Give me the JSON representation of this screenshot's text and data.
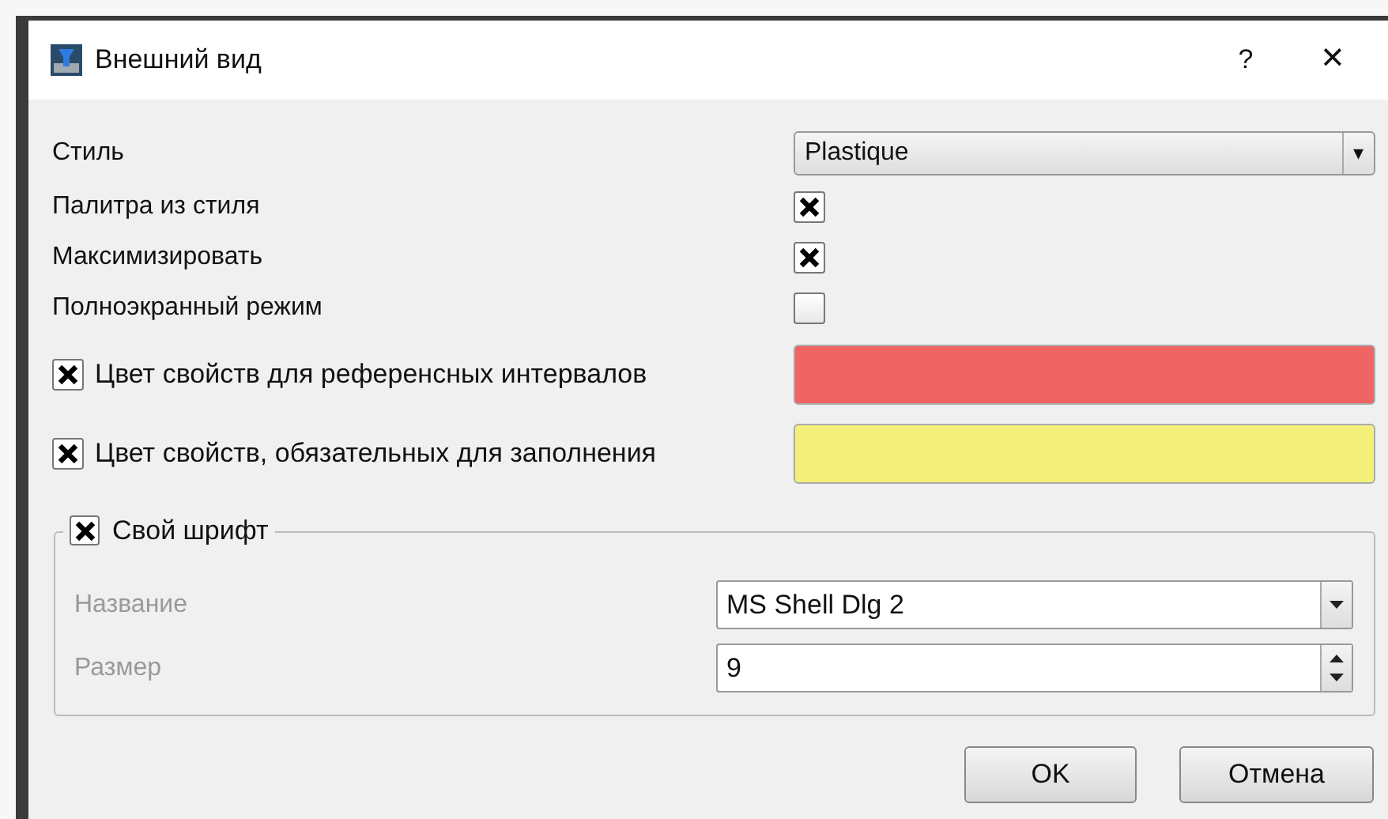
{
  "window": {
    "title": "Внешний вид",
    "help": "?",
    "close": "✕"
  },
  "style": {
    "label": "Стиль",
    "value": "Plastique",
    "arrow": "▾"
  },
  "options": [
    {
      "label": "Палитра из стиля",
      "checked": true
    },
    {
      "label": "Максимизировать",
      "checked": true
    },
    {
      "label": "Полноэкранный режим",
      "checked": false
    }
  ],
  "color_options": [
    {
      "label": "Цвет свойств для референсных интервалов",
      "checked": true,
      "color": "#f06464"
    },
    {
      "label": "Цвет свойств, обязательных для заполнения",
      "checked": true,
      "color": "#f3f07a"
    }
  ],
  "font_group": {
    "label": "Свой шрифт",
    "checked": true,
    "name_label": "Название",
    "name_value": "MS Shell Dlg 2",
    "size_label": "Размер",
    "size_value": "9"
  },
  "buttons": [
    "OK",
    "Отмена"
  ]
}
